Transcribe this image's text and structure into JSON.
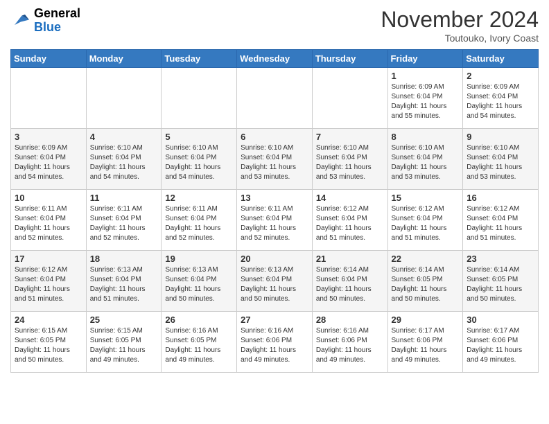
{
  "header": {
    "logo_general": "General",
    "logo_blue": "Blue",
    "month_title": "November 2024",
    "location": "Toutouko, Ivory Coast"
  },
  "weekdays": [
    "Sunday",
    "Monday",
    "Tuesday",
    "Wednesday",
    "Thursday",
    "Friday",
    "Saturday"
  ],
  "weeks": [
    [
      {
        "day": "",
        "info": ""
      },
      {
        "day": "",
        "info": ""
      },
      {
        "day": "",
        "info": ""
      },
      {
        "day": "",
        "info": ""
      },
      {
        "day": "",
        "info": ""
      },
      {
        "day": "1",
        "info": "Sunrise: 6:09 AM\nSunset: 6:04 PM\nDaylight: 11 hours\nand 55 minutes."
      },
      {
        "day": "2",
        "info": "Sunrise: 6:09 AM\nSunset: 6:04 PM\nDaylight: 11 hours\nand 54 minutes."
      }
    ],
    [
      {
        "day": "3",
        "info": "Sunrise: 6:09 AM\nSunset: 6:04 PM\nDaylight: 11 hours\nand 54 minutes."
      },
      {
        "day": "4",
        "info": "Sunrise: 6:10 AM\nSunset: 6:04 PM\nDaylight: 11 hours\nand 54 minutes."
      },
      {
        "day": "5",
        "info": "Sunrise: 6:10 AM\nSunset: 6:04 PM\nDaylight: 11 hours\nand 54 minutes."
      },
      {
        "day": "6",
        "info": "Sunrise: 6:10 AM\nSunset: 6:04 PM\nDaylight: 11 hours\nand 53 minutes."
      },
      {
        "day": "7",
        "info": "Sunrise: 6:10 AM\nSunset: 6:04 PM\nDaylight: 11 hours\nand 53 minutes."
      },
      {
        "day": "8",
        "info": "Sunrise: 6:10 AM\nSunset: 6:04 PM\nDaylight: 11 hours\nand 53 minutes."
      },
      {
        "day": "9",
        "info": "Sunrise: 6:10 AM\nSunset: 6:04 PM\nDaylight: 11 hours\nand 53 minutes."
      }
    ],
    [
      {
        "day": "10",
        "info": "Sunrise: 6:11 AM\nSunset: 6:04 PM\nDaylight: 11 hours\nand 52 minutes."
      },
      {
        "day": "11",
        "info": "Sunrise: 6:11 AM\nSunset: 6:04 PM\nDaylight: 11 hours\nand 52 minutes."
      },
      {
        "day": "12",
        "info": "Sunrise: 6:11 AM\nSunset: 6:04 PM\nDaylight: 11 hours\nand 52 minutes."
      },
      {
        "day": "13",
        "info": "Sunrise: 6:11 AM\nSunset: 6:04 PM\nDaylight: 11 hours\nand 52 minutes."
      },
      {
        "day": "14",
        "info": "Sunrise: 6:12 AM\nSunset: 6:04 PM\nDaylight: 11 hours\nand 51 minutes."
      },
      {
        "day": "15",
        "info": "Sunrise: 6:12 AM\nSunset: 6:04 PM\nDaylight: 11 hours\nand 51 minutes."
      },
      {
        "day": "16",
        "info": "Sunrise: 6:12 AM\nSunset: 6:04 PM\nDaylight: 11 hours\nand 51 minutes."
      }
    ],
    [
      {
        "day": "17",
        "info": "Sunrise: 6:12 AM\nSunset: 6:04 PM\nDaylight: 11 hours\nand 51 minutes."
      },
      {
        "day": "18",
        "info": "Sunrise: 6:13 AM\nSunset: 6:04 PM\nDaylight: 11 hours\nand 51 minutes."
      },
      {
        "day": "19",
        "info": "Sunrise: 6:13 AM\nSunset: 6:04 PM\nDaylight: 11 hours\nand 50 minutes."
      },
      {
        "day": "20",
        "info": "Sunrise: 6:13 AM\nSunset: 6:04 PM\nDaylight: 11 hours\nand 50 minutes."
      },
      {
        "day": "21",
        "info": "Sunrise: 6:14 AM\nSunset: 6:04 PM\nDaylight: 11 hours\nand 50 minutes."
      },
      {
        "day": "22",
        "info": "Sunrise: 6:14 AM\nSunset: 6:05 PM\nDaylight: 11 hours\nand 50 minutes."
      },
      {
        "day": "23",
        "info": "Sunrise: 6:14 AM\nSunset: 6:05 PM\nDaylight: 11 hours\nand 50 minutes."
      }
    ],
    [
      {
        "day": "24",
        "info": "Sunrise: 6:15 AM\nSunset: 6:05 PM\nDaylight: 11 hours\nand 50 minutes."
      },
      {
        "day": "25",
        "info": "Sunrise: 6:15 AM\nSunset: 6:05 PM\nDaylight: 11 hours\nand 49 minutes."
      },
      {
        "day": "26",
        "info": "Sunrise: 6:16 AM\nSunset: 6:05 PM\nDaylight: 11 hours\nand 49 minutes."
      },
      {
        "day": "27",
        "info": "Sunrise: 6:16 AM\nSunset: 6:06 PM\nDaylight: 11 hours\nand 49 minutes."
      },
      {
        "day": "28",
        "info": "Sunrise: 6:16 AM\nSunset: 6:06 PM\nDaylight: 11 hours\nand 49 minutes."
      },
      {
        "day": "29",
        "info": "Sunrise: 6:17 AM\nSunset: 6:06 PM\nDaylight: 11 hours\nand 49 minutes."
      },
      {
        "day": "30",
        "info": "Sunrise: 6:17 AM\nSunset: 6:06 PM\nDaylight: 11 hours\nand 49 minutes."
      }
    ]
  ]
}
